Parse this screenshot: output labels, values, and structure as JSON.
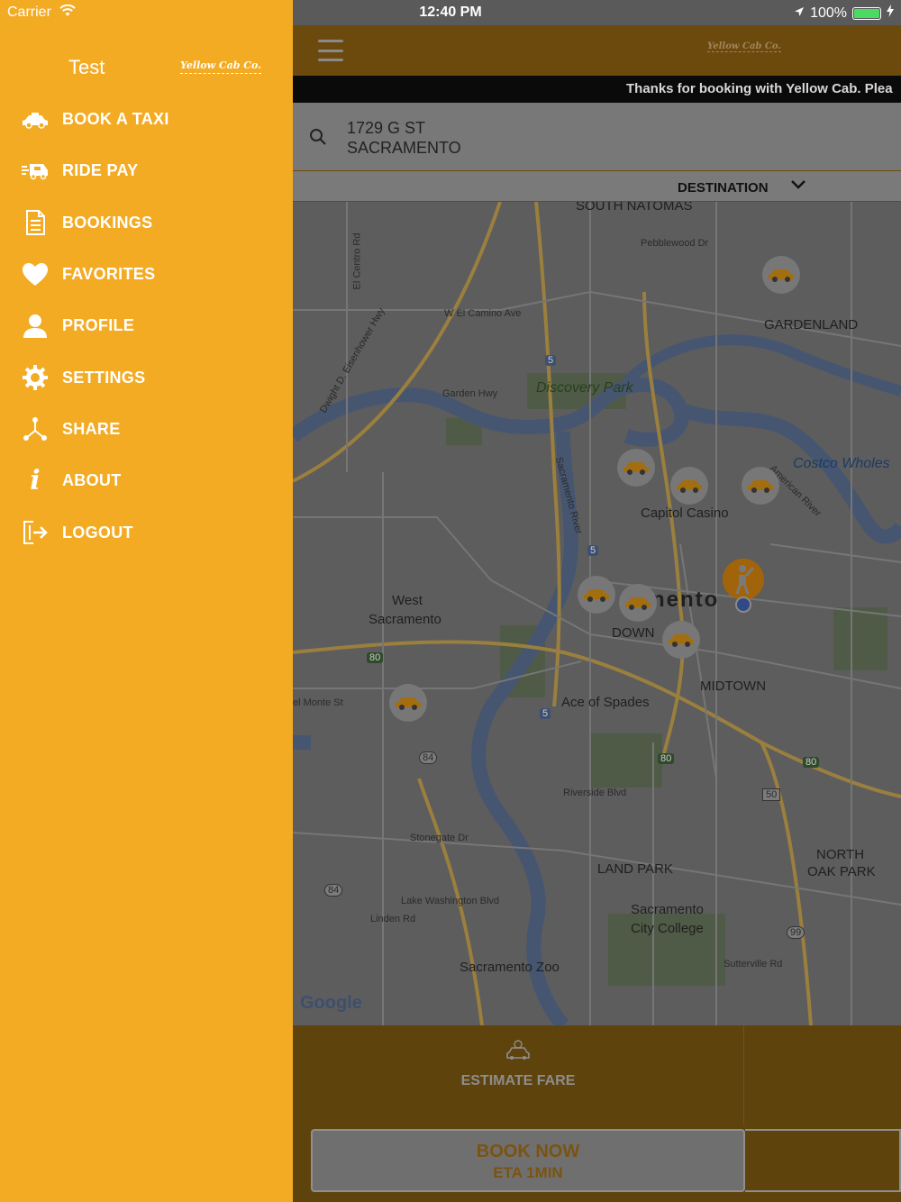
{
  "status_bar": {
    "carrier": "Carrier",
    "time": "12:40 PM",
    "battery": "100%"
  },
  "drawer": {
    "user_name": "Test",
    "brand": "Yellow Cab Co.",
    "items": [
      {
        "label": "BOOK A TAXI",
        "icon": "taxi-icon"
      },
      {
        "label": "RIDE PAY",
        "icon": "ride-pay-icon"
      },
      {
        "label": "BOOKINGS",
        "icon": "document-icon"
      },
      {
        "label": "FAVORITES",
        "icon": "heart-icon"
      },
      {
        "label": "PROFILE",
        "icon": "person-icon"
      },
      {
        "label": "SETTINGS",
        "icon": "gear-icon"
      },
      {
        "label": "SHARE",
        "icon": "share-icon"
      },
      {
        "label": "ABOUT",
        "icon": "info-icon"
      },
      {
        "label": "LOGOUT",
        "icon": "logout-icon"
      }
    ]
  },
  "main": {
    "brand": "Yellow Cab Co.",
    "ticker": "Thanks for booking with Yellow Cab. Plea",
    "pickup": {
      "line1": "1729 G ST",
      "line2": "SACRAMENTO"
    },
    "destination_label": "DESTINATION",
    "map_labels": {
      "south_natomas": "SOUTH NATOMAS",
      "gardenland": "GARDENLAND",
      "discovery_park": "Discovery Park",
      "costco": "Costco Wholes",
      "capitol_casino": "Capitol Casino",
      "sacramento": "nento",
      "west_sac_1": "West",
      "west_sac_2": "Sacramento",
      "down": "DOWN",
      "midtown": "MIDTOWN",
      "ace_of_spades": "Ace of Spades",
      "land_park": "LAND PARK",
      "north_oak_park_1": "NORTH",
      "north_oak_park_2": "OAK PARK",
      "sac_city_college_1": "Sacramento",
      "sac_city_college_2": "City College",
      "sac_zoo": "Sacramento Zoo",
      "google": "Google",
      "w_el_camino": "W El Camino Ave",
      "garden_hwy": "Garden Hwy",
      "el_monte": "el Monte St",
      "sacramento_river": "Sacramento River",
      "american_river": "American River",
      "stonegate": "Stonegate Dr",
      "lake_washington": "Lake Washington Blvd",
      "linden": "Linden Rd",
      "sutterville": "Sutterville Rd",
      "riverside": "Riverside Blvd",
      "pebblewood": "Pebblewood Dr",
      "el_centro": "El Centro Rd",
      "eisenhower": "Dwight D. Eisenhower Hwy",
      "i5_a": "5",
      "i5_b": "5",
      "i5_c": "5",
      "i80_a": "80",
      "i80_b": "80",
      "i80_c": "80",
      "hwy84_a": "84",
      "hwy84_b": "84",
      "us50": "50",
      "hwy99": "99"
    },
    "estimate_label": "ESTIMATE FARE",
    "book_now": {
      "line1": "BOOK NOW",
      "line2": "ETA 1MIN"
    }
  },
  "colors": {
    "accent": "#f4ab24",
    "dim_brown": "#5f430d"
  }
}
